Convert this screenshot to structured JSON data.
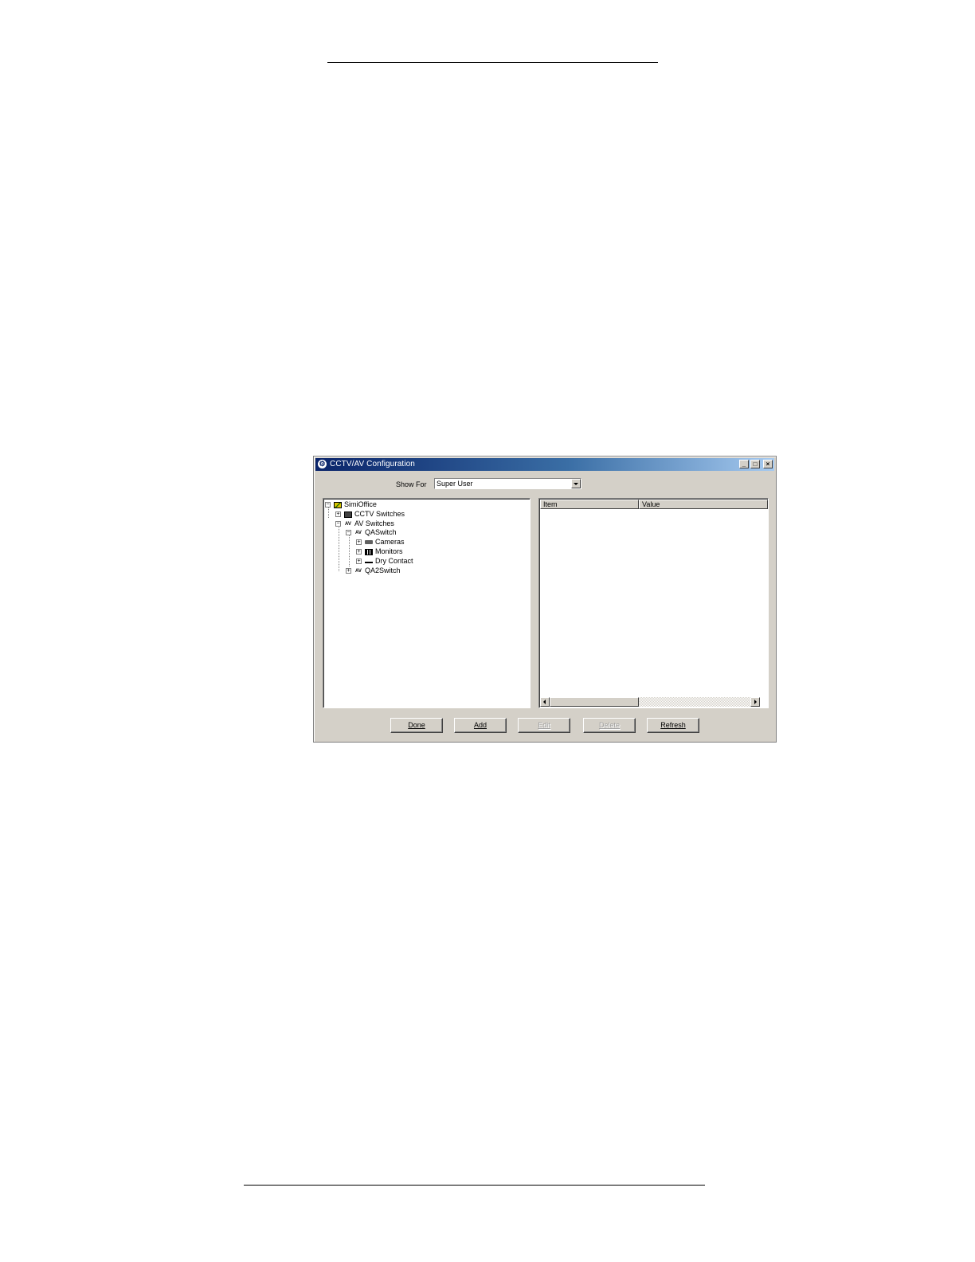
{
  "window": {
    "title": "CCTV/AV Configuration",
    "controls": {
      "minimize": "_",
      "maximize": "□",
      "close": "×"
    }
  },
  "show_for": {
    "label": "Show For",
    "selected": "Super User"
  },
  "tree": {
    "nodes": [
      {
        "label": "SimiOffice",
        "expander": "−",
        "icon": "site-icon"
      },
      {
        "label": "CCTV Switches",
        "expander": "+",
        "icon": "cctv-switch-icon"
      },
      {
        "label": "AV Switches",
        "expander": "−",
        "icon": "av-icon",
        "icon_text": "AV"
      },
      {
        "label": "QASwitch",
        "expander": "−",
        "icon": "av-icon",
        "icon_text": "AV"
      },
      {
        "label": "Cameras",
        "expander": "+",
        "icon": "camera-icon"
      },
      {
        "label": "Monitors",
        "expander": "+",
        "icon": "monitor-icon"
      },
      {
        "label": "Dry Contact",
        "expander": "+",
        "icon": "dry-contact-icon"
      },
      {
        "label": "QA2Switch",
        "expander": "+",
        "icon": "av-icon",
        "icon_text": "AV"
      }
    ]
  },
  "list": {
    "columns": [
      "Item",
      "Value"
    ]
  },
  "buttons": {
    "done": "Done",
    "add": "Add",
    "edit": "Edit",
    "delete": "Delete",
    "refresh": "Refresh"
  }
}
